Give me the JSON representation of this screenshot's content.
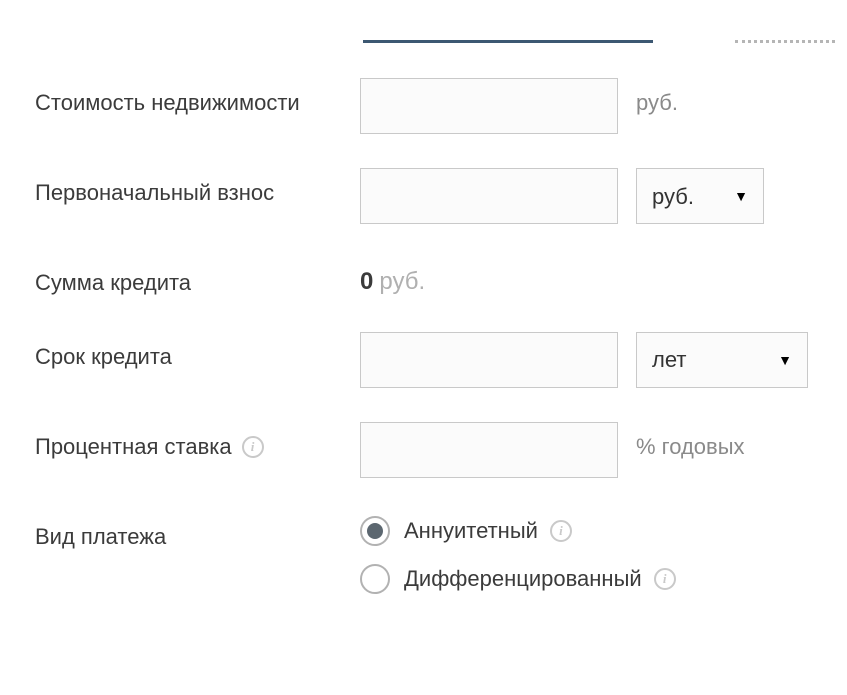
{
  "labels": {
    "property_cost": "Стоимость недвижимости",
    "down_payment": "Первоначальный взнос",
    "loan_amount": "Сумма кредита",
    "loan_term": "Срок кредита",
    "interest_rate": "Процентная ставка",
    "payment_type": "Вид платежа"
  },
  "units": {
    "rub": "руб.",
    "percent_annual": "% годовых"
  },
  "selects": {
    "down_payment_unit": "руб.",
    "term_unit": "лет"
  },
  "loan_sum": {
    "value": "0",
    "unit": "руб."
  },
  "radio": {
    "annuity": "Аннуитетный",
    "differentiated": "Дифференцированный"
  }
}
